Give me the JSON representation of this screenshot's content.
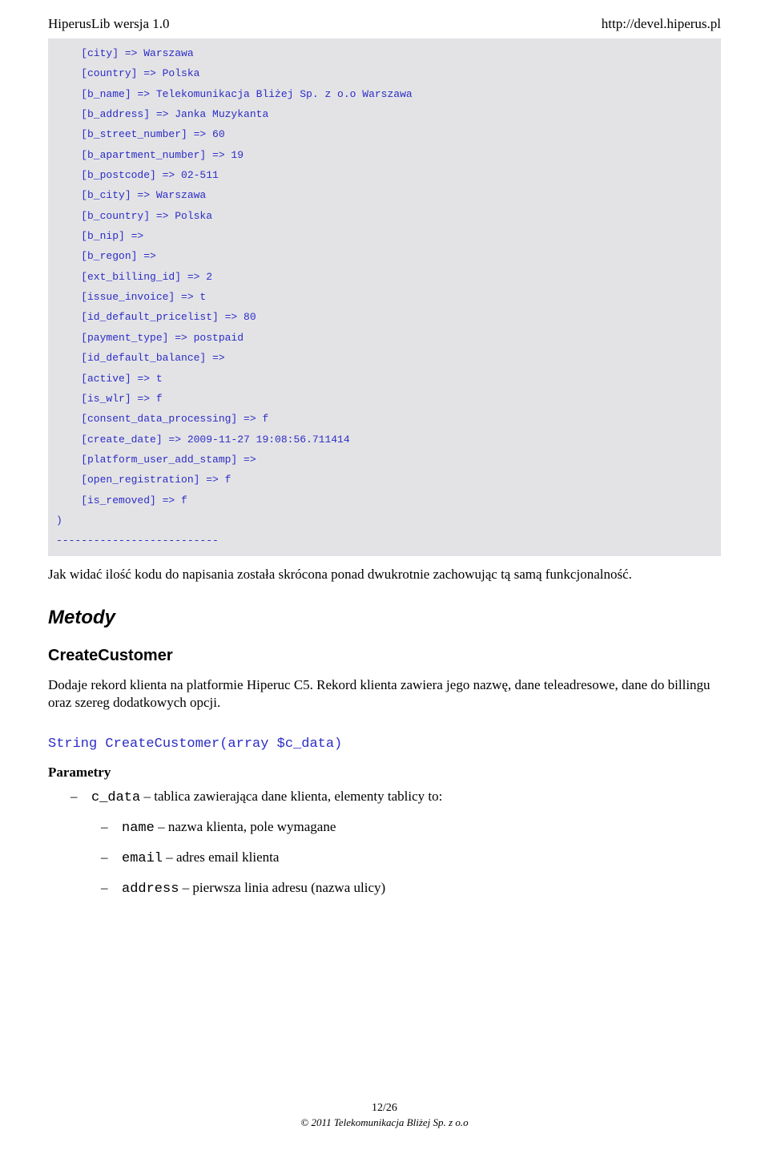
{
  "header": {
    "left": "HiperusLib wersja 1.0",
    "right": "http://devel.hiperus.pl"
  },
  "code": {
    "lines": [
      "    [city] => Warszawa",
      "    [country] => Polska",
      "    [b_name] => Telekomunikacja Bliżej Sp. z o.o Warszawa",
      "    [b_address] => Janka Muzykanta",
      "    [b_street_number] => 60",
      "    [b_apartment_number] => 19",
      "    [b_postcode] => 02-511",
      "    [b_city] => Warszawa",
      "    [b_country] => Polska",
      "    [b_nip] =>",
      "    [b_regon] =>",
      "    [ext_billing_id] => 2",
      "    [issue_invoice] => t",
      "    [id_default_pricelist] => 80",
      "    [payment_type] => postpaid",
      "    [id_default_balance] =>",
      "    [active] => t",
      "    [is_wlr] => f",
      "    [consent_data_processing] => f",
      "    [create_date] => 2009-11-27 19:08:56.711414",
      "    [platform_user_add_stamp] =>",
      "    [open_registration] => f",
      "    [is_removed] => f",
      ")",
      "--------------------------"
    ]
  },
  "body": {
    "after_code": "Jak widać ilość kodu do napisania została skrócona ponad dwukrotnie zachowując tą samą funkcjonalność.",
    "h2_metody": "Metody",
    "h3_create": "CreateCustomer",
    "create_desc": "Dodaje rekord klienta na platformie Hiperuc C5. Rekord klienta zawiera jego nazwę, dane teleadresowe, dane do billingu oraz szereg dodatkowych opcji.",
    "signature": "String CreateCustomer(array $c_data)",
    "parametry": "Parametry",
    "params": {
      "c_data_code": "c_data",
      "c_data_desc": " – tablica zawierająca dane klienta, elementy tablicy to:",
      "name_code": "name",
      "name_desc": " – nazwa klienta, pole wymagane",
      "email_code": "email",
      "email_desc": " – adres email klienta",
      "address_code": "address",
      "address_desc": " – pierwsza linia adresu (nazwa ulicy)"
    }
  },
  "footer": {
    "page": "12/26",
    "copyright": "© 2011 Telekomunikacja Bliżej Sp. z o.o"
  }
}
